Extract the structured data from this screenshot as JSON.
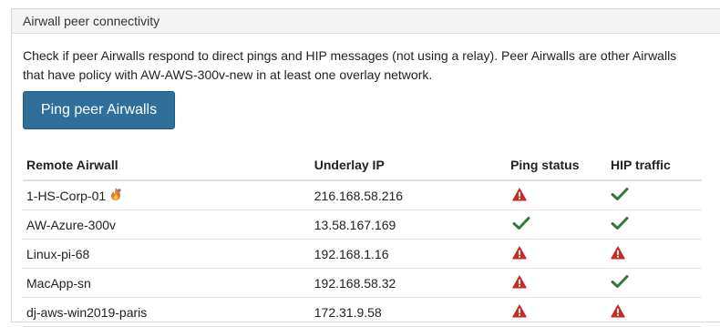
{
  "panel": {
    "title": "Airwall peer connectivity",
    "description": "Check if peer Airwalls respond to direct pings and HIP messages (not using a relay). Peer Airwalls are other Airwalls that have policy with AW-AWS-300v-new in at least one overlay network.",
    "ping_button_label": "Ping peer Airwalls"
  },
  "table": {
    "headers": {
      "remote_airwall": "Remote Airwall",
      "underlay_ip": "Underlay IP",
      "ping_status": "Ping status",
      "hip_traffic": "HIP traffic"
    },
    "rows": [
      {
        "name": "1-HS-Corp-01",
        "ip": "216.168.58.216",
        "ping": "warning",
        "hip": "ok",
        "badge": "flame-icon"
      },
      {
        "name": "AW-Azure-300v",
        "ip": "13.58.167.169",
        "ping": "ok",
        "hip": "ok",
        "badge": ""
      },
      {
        "name": "Linux-pi-68",
        "ip": "192.168.1.16",
        "ping": "warning",
        "hip": "warning",
        "badge": ""
      },
      {
        "name": "MacApp-sn",
        "ip": "192.168.58.32",
        "ping": "warning",
        "hip": "ok",
        "badge": ""
      },
      {
        "name": "dj-aws-win2019-paris",
        "ip": "172.31.9.58",
        "ping": "warning",
        "hip": "warning",
        "badge": ""
      }
    ]
  },
  "colors": {
    "ok": "#2e7d32",
    "warning": "#c62828",
    "button": "#2f6f99"
  }
}
